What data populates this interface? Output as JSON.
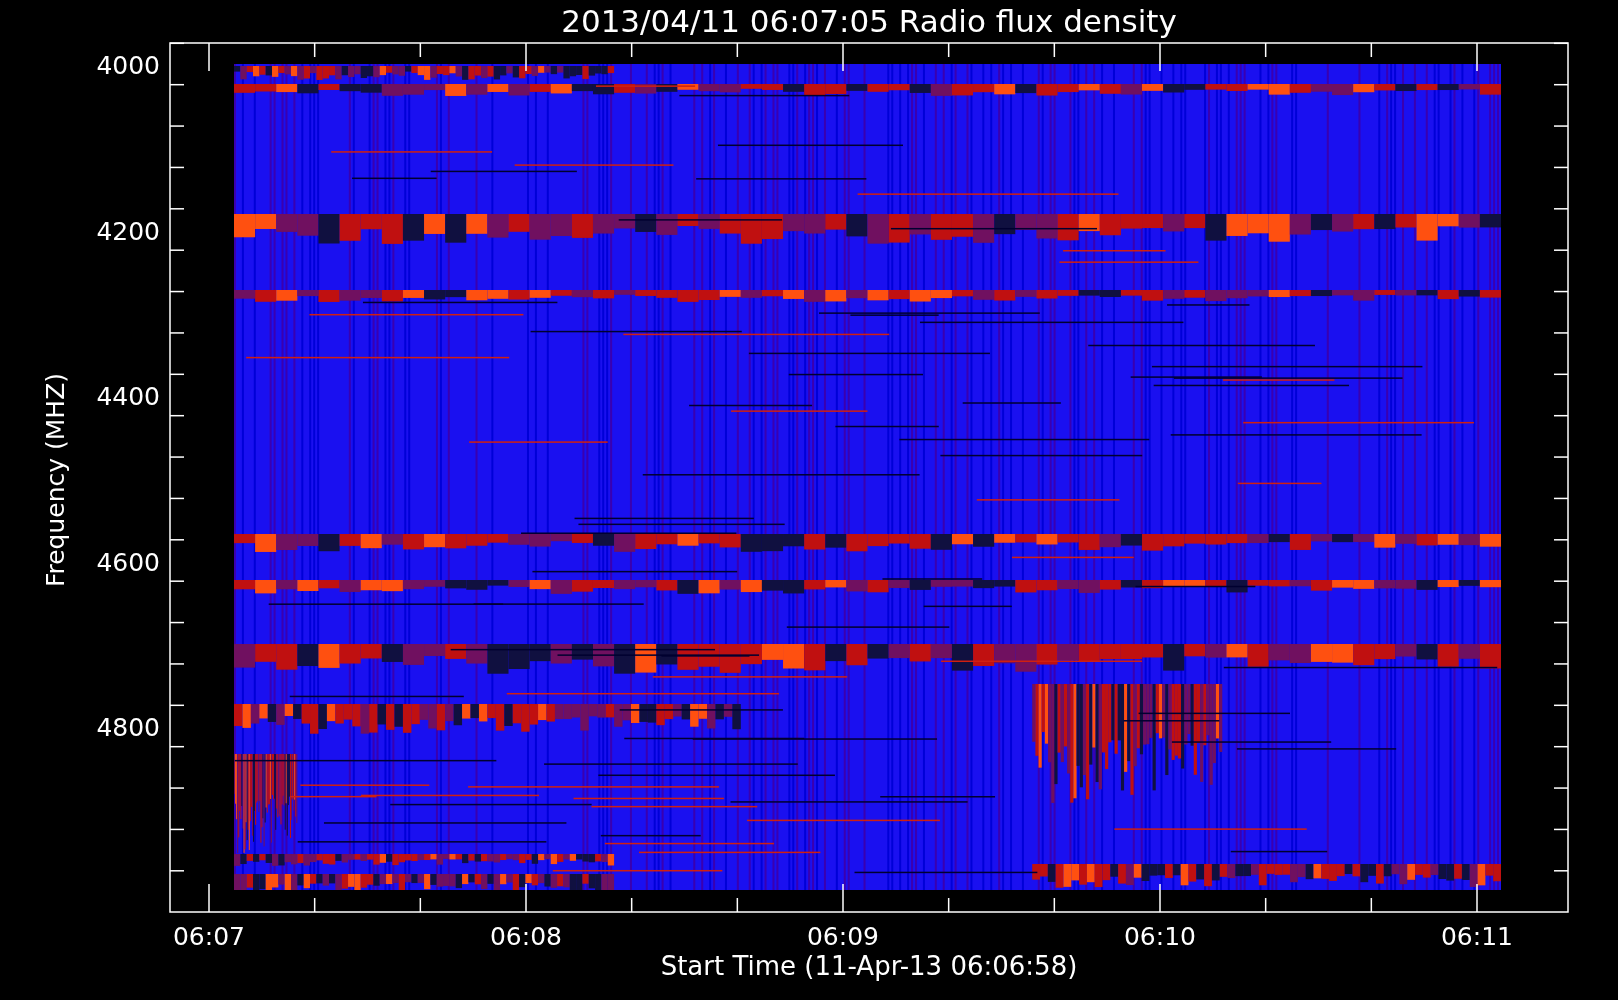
{
  "plot": {
    "title": "2013/04/11 06:07:05 Radio flux density",
    "xlabel": "Start Time (11-Apr-13 06:06:58)",
    "ylabel": "Frequency (MHZ)",
    "xticks": [
      "06:07",
      "06:08",
      "06:09",
      "06:10",
      "06:11"
    ],
    "yticks": [
      "4000",
      "4200",
      "4400",
      "4600",
      "4800"
    ]
  }
}
